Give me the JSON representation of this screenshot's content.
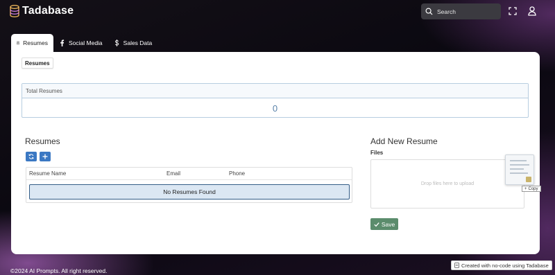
{
  "app": {
    "logo_text": "Tadabase"
  },
  "header": {
    "search_placeholder": "Search"
  },
  "tabs": [
    {
      "label": "Resumes",
      "icon": "user-card-icon"
    },
    {
      "label": "Social Media",
      "icon": "facebook-icon"
    },
    {
      "label": "Sales Data",
      "icon": "dollar-icon"
    }
  ],
  "subtab": {
    "label": "Resumes"
  },
  "stat": {
    "title": "Total Resumes",
    "value": "0"
  },
  "resumes": {
    "title": "Resumes",
    "columns": [
      "Resume Name",
      "Email",
      "Phone"
    ],
    "empty_text": "No Resumes Found"
  },
  "form": {
    "title": "Add New Resume",
    "files_label": "Files",
    "dropzone_text": "Drop files here to upload",
    "drag_tip": "Copy",
    "save_label": "Save"
  },
  "footer": {
    "copyright": "©2024 AI Prompts. All right reserved.",
    "made_with": "Created with no-code using Tadabase"
  },
  "colors": {
    "accent_blue": "#3b78c3",
    "save_green": "#5b8c6c",
    "stat_value": "#5a82aa"
  }
}
